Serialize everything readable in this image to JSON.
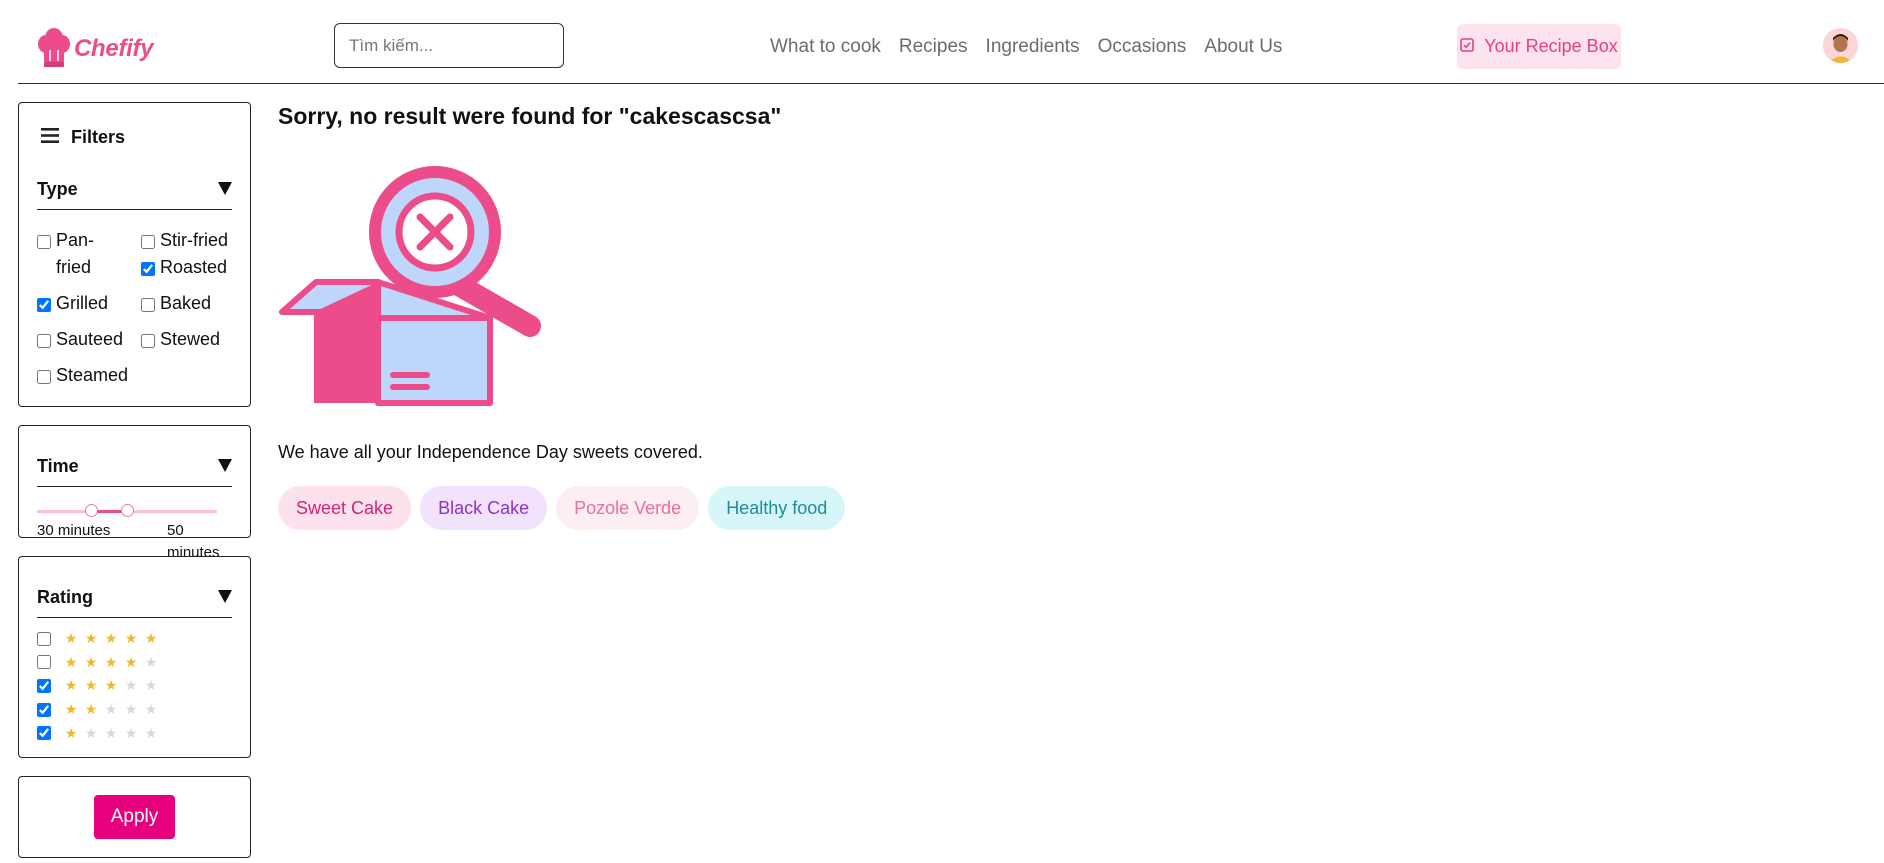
{
  "header": {
    "brand": "Chefify",
    "search_placeholder": "Tìm kiếm...",
    "nav": [
      "What to cook",
      "Recipes",
      "Ingredients",
      "Occasions",
      "About Us"
    ],
    "recipe_box_label": "Your Recipe Box"
  },
  "sidebar": {
    "filters_label": "Filters",
    "type": {
      "title": "Type",
      "options": [
        {
          "label": "Pan-fried",
          "checked": false
        },
        {
          "label": "Stir-fried",
          "checked": false
        },
        {
          "label": "Grilled",
          "checked": true
        },
        {
          "label": "Roasted",
          "checked": true
        },
        {
          "label": "Sauteed",
          "checked": false
        },
        {
          "label": "Baked",
          "checked": false
        },
        {
          "label": "Steamed",
          "checked": false
        },
        {
          "label": "Stewed",
          "checked": false
        }
      ]
    },
    "time": {
      "title": "Time",
      "min_label": "30 minutes",
      "max_label": "50 minutes",
      "min_value": 30,
      "max_value": 50
    },
    "rating": {
      "title": "Rating",
      "options": [
        {
          "stars": 5,
          "checked": false
        },
        {
          "stars": 4,
          "checked": false
        },
        {
          "stars": 3,
          "checked": true
        },
        {
          "stars": 2,
          "checked": true
        },
        {
          "stars": 1,
          "checked": true
        }
      ]
    },
    "apply_label": "Apply"
  },
  "main": {
    "title": "Sorry, no result were found for \"cakescascsa\"",
    "description": "We have all your Independence Day sweets covered.",
    "chips": [
      {
        "label": "Sweet Cake",
        "bg": "#fde2ee",
        "color": "#d4237a"
      },
      {
        "label": "Black Cake",
        "bg": "#f2e2fb",
        "color": "#8e35c4"
      },
      {
        "label": "Pozole Verde",
        "bg": "#fdeef4",
        "color": "#ec6ea0"
      },
      {
        "label": "Healthy food",
        "bg": "#d6f6fa",
        "color": "#1e8c9c"
      }
    ]
  },
  "colors": {
    "accent": "#ec4d8a",
    "apply": "#e6007e",
    "star_on": "#f2b927",
    "star_off": "#d8d8d8"
  }
}
